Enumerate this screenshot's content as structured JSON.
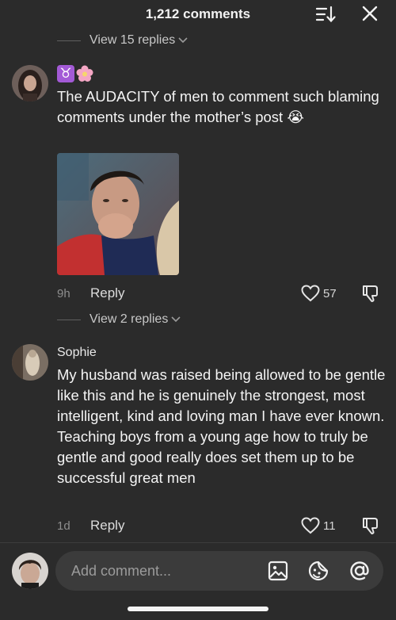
{
  "header": {
    "title": "1,212 comments",
    "sort_icon": "sort-icon",
    "close_icon": "close-icon"
  },
  "top_replies": {
    "label": "View 15 replies"
  },
  "comments": [
    {
      "username_emojis": [
        "♉",
        "🌸"
      ],
      "text": "The AUDACITY of men to comment such blaming comments under the mother’s post 😭",
      "time": "9h",
      "reply_label": "Reply",
      "likes": "57",
      "replies_label": "View 2 replies"
    },
    {
      "username": "Sophie",
      "text": "My husband was raised being allowed to be gentle like this and he is genuinely the strongest, most intelligent, kind and loving man I have ever known. Teaching boys from a young age how to truly be gentle and good really does set them up to be successful great men",
      "time": "1d",
      "reply_label": "Reply",
      "likes": "11"
    }
  ],
  "composer": {
    "placeholder": "Add comment...",
    "icons": [
      "image-icon",
      "emoji-icon",
      "mention-icon"
    ]
  },
  "colors": {
    "background": "#2b2b2b",
    "input_background": "#3b3b3b",
    "muted_text": "#8e8e8e"
  }
}
